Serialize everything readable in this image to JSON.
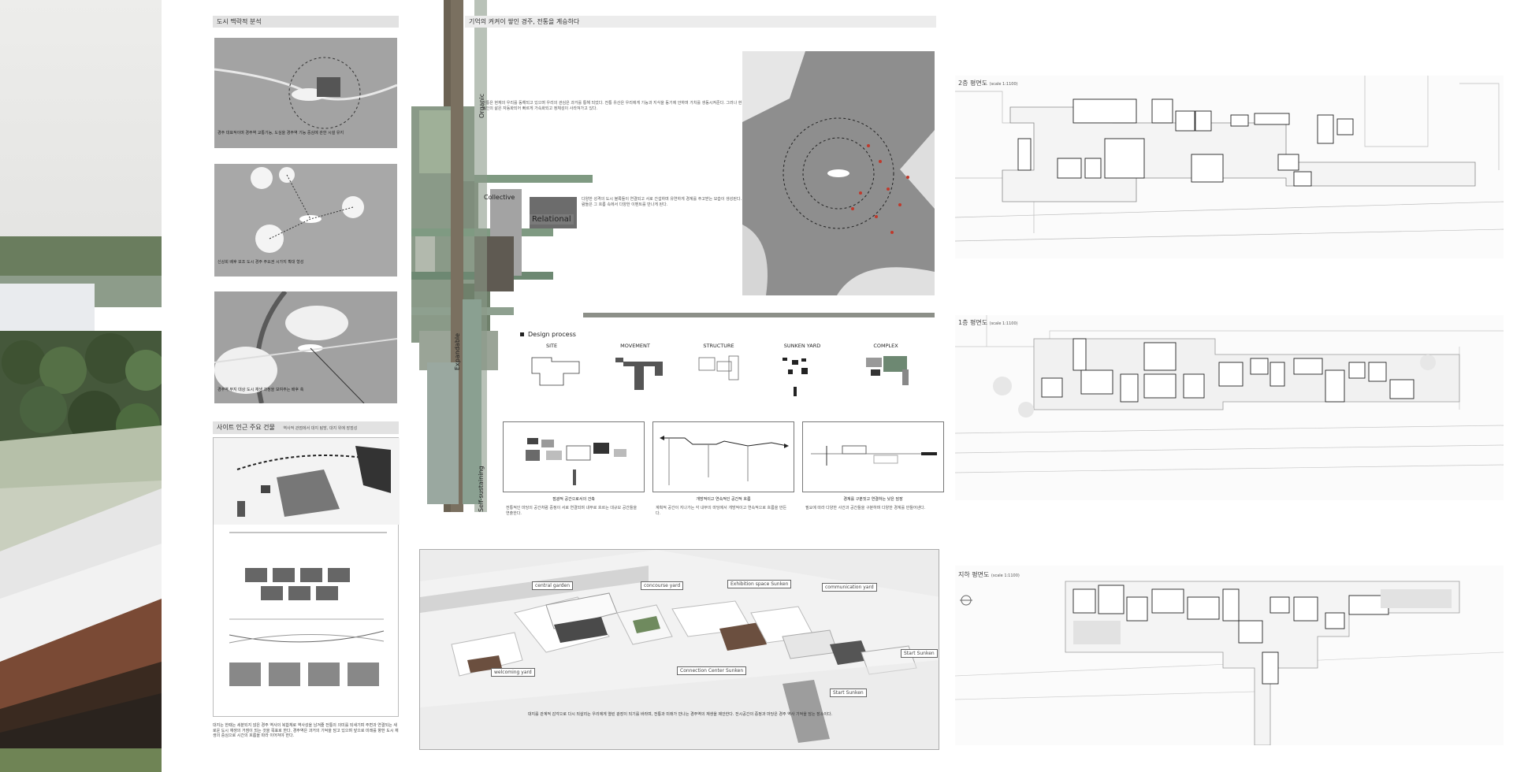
{
  "sections": {
    "urban_context": "도시 맥락적 분석",
    "site_buildings": "사이트 인근 주요 건물",
    "site_buildings_sub": "역사적 관점에서 대지 탐방, 대지 위에 장점성",
    "hero_title": "기억의 켜켜이 쌓인 경주, 전통을 계승하다",
    "design_process": "Design process"
  },
  "map_captions": [
    "경주 대표적이며 경주역 교통기능, 도심을 경주역 기능 중심에 관한 시설 유지",
    "신상희 배후 보조 도시 경주 주요권 시가지 확대 형성",
    "경주역 부지 대상 도시 재생 과정을 보여주는 배후 축"
  ],
  "concept_labels": {
    "organic": "Organic",
    "collective": "Collective",
    "relational": "Relational",
    "expandable": "Expandable",
    "self_sustaining": "Self-sustaining"
  },
  "intro_text": "전통은 현재의 우리를 동해되고 있으며 우리의 관심은 과거를 통해 되었다. 전통 유산은 우리에게 기능과 지식을 동기에 안하며 가치를 생동시켜준다. 그러나 현대인의 삶은 자동화되어 빠르게 가속화되고 정체성이 사라져가고 있다.",
  "relational_text": "다양한 성격의 도시 블록들이 연결되고 서로 간섭하며 유연하게 경계를 주고받는 모습이 생성된다. 사람들은 그 흐름 속에서 다양한 이벤트를 만나게 된다.",
  "process_steps": [
    "SITE",
    "MOVEMENT",
    "STRUCTURE",
    "SUNKEN YARD",
    "COMPLEX"
  ],
  "diagram_captions": [
    "점광적 공간으로서의 건축",
    "개방적이고 연속적인 공간적 흐름",
    "경계를 구분짓고 연결하는 낮은 담장"
  ],
  "diagram_texts": [
    "전통적인 마당의 공간처럼 중정이 서로 연결되며 내부로 흐르는 대규모 공간들을 연출한다.",
    "계획적 공간이 지나가는 각 내부의 마당에서 개방적이고 연속적으로 흐름을 만든다.",
    "필요에 따라 다양한 사건과 공간들을 구분하며 다양한 경계를 만들어낸다."
  ],
  "aerial_tags": [
    "central garden",
    "concourse yard",
    "Exhibition space Sunken",
    "communication yard",
    "welcoming yard",
    "Connection Center Sunken",
    "Start Sunken",
    "Start Sunken"
  ],
  "aerial_text": "대지를 관계적 감각으로 다시 되살리는 우리에게 열린 광장이 되기를 바라며, 전통과 미래가 만나는 경주역의 재생을 제안한다. 전시공간의 중정과 마당은 경주 역사 기억을 담는 장소이다.",
  "plans": {
    "floor2": "2층 평면도",
    "floor2_scale": "(scale 1:1100)",
    "floor1": "1층 평면도",
    "floor1_scale": "(scale 1:1100)",
    "basement": "지하 평면도",
    "basement_scale": "(scale 1:1100)"
  },
  "bottom_left_text": "대지는 한때는 세분되지 않은 경주 역사의 복합체로 역사성을 남겨줄 전통의 의미를 되새기며 주변과 연결되는 새로운 도시 재생의 거점이 되는 것을 목표로 한다. 경주역은 과거의 기억을 담고 있으며 앞으로 미래를 향한 도시 재생의 중심으로 시간의 흐름을 따라 이어져야 한다.",
  "colors": {
    "header_bg": "#e2e2e2",
    "concept_green": "#7f9a82",
    "concept_brown": "#6b6253",
    "plan_bg": "#fbfbfb"
  }
}
